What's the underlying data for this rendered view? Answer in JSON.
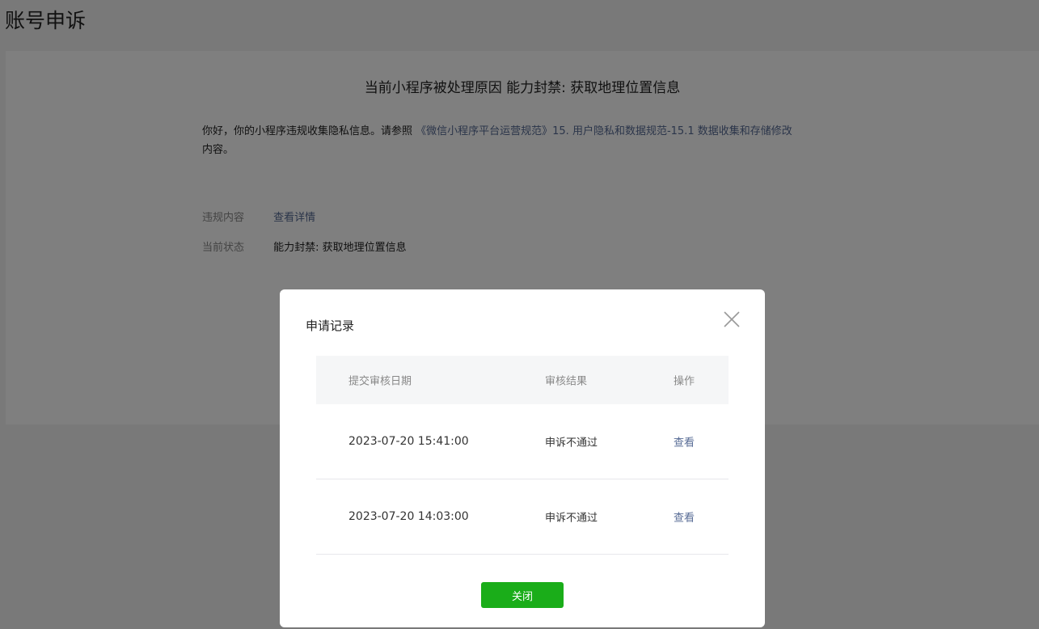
{
  "page": {
    "title": "账号申诉"
  },
  "card": {
    "heading": "当前小程序被处理原因 能力封禁: 获取地理位置信息",
    "notice_prefix": "你好，你的小程序违规收集隐私信息。请参照 ",
    "notice_link": "《微信小程序平台运营规范》15. 用户隐私和数据规范-15.1 数据收集和存储修改",
    "notice_suffix": "内容。",
    "violation_label": "违规内容",
    "violation_value": "查看详情",
    "status_label": "当前状态",
    "status_value": "能力封禁: 获取地理位置信息"
  },
  "dialog": {
    "title": "申请记录",
    "columns": {
      "date": "提交审核日期",
      "result": "审核结果",
      "action": "操作"
    },
    "rows": [
      {
        "date": "2023-07-20 15:41:00",
        "result": "申诉不通过",
        "action": "查看"
      },
      {
        "date": "2023-07-20 14:03:00",
        "result": "申诉不通过",
        "action": "查看"
      }
    ],
    "close_button": "关闭"
  }
}
